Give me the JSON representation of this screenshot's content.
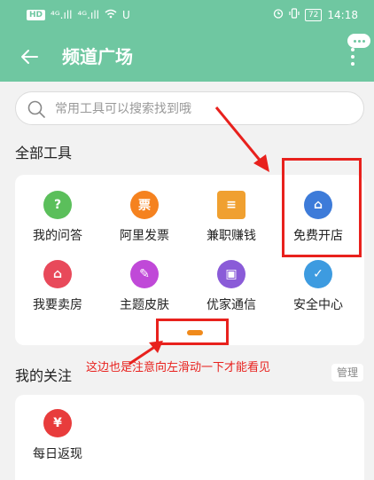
{
  "statusbar": {
    "left": [
      "HD",
      "⁴ᴳ.ıll",
      "⁴ᴳ.ıll",
      "wifi",
      "U"
    ],
    "battery": "72",
    "time": "14:18"
  },
  "header": {
    "title": "频道广场"
  },
  "search": {
    "placeholder": "常用工具可以搜索找到哦"
  },
  "sections": {
    "all_tools": "全部工具",
    "my_follow": "我的关注"
  },
  "tools": [
    {
      "label": "我的问答",
      "glyph": "?",
      "color": "#5bbf5b"
    },
    {
      "label": "阿里发票",
      "glyph": "票",
      "color": "#f5821f"
    },
    {
      "label": "兼职赚钱",
      "glyph": "≡",
      "color": "#f0a030"
    },
    {
      "label": "免费开店",
      "glyph": "⌂",
      "color": "#3d7bd9"
    },
    {
      "label": "我要卖房",
      "glyph": "⌂",
      "color": "#e8495a"
    },
    {
      "label": "主题皮肤",
      "glyph": "✎",
      "color": "#c049d8"
    },
    {
      "label": "优家通信",
      "glyph": "▣",
      "color": "#8a5bd8"
    },
    {
      "label": "安全中心",
      "glyph": "✓",
      "color": "#3d9be0"
    }
  ],
  "manage_label": "管理",
  "annotation": "这边也是注意向左滑动一下才能看见",
  "follow": [
    {
      "label": "每日返现",
      "glyph": "¥",
      "color": "#e83c3c"
    }
  ]
}
